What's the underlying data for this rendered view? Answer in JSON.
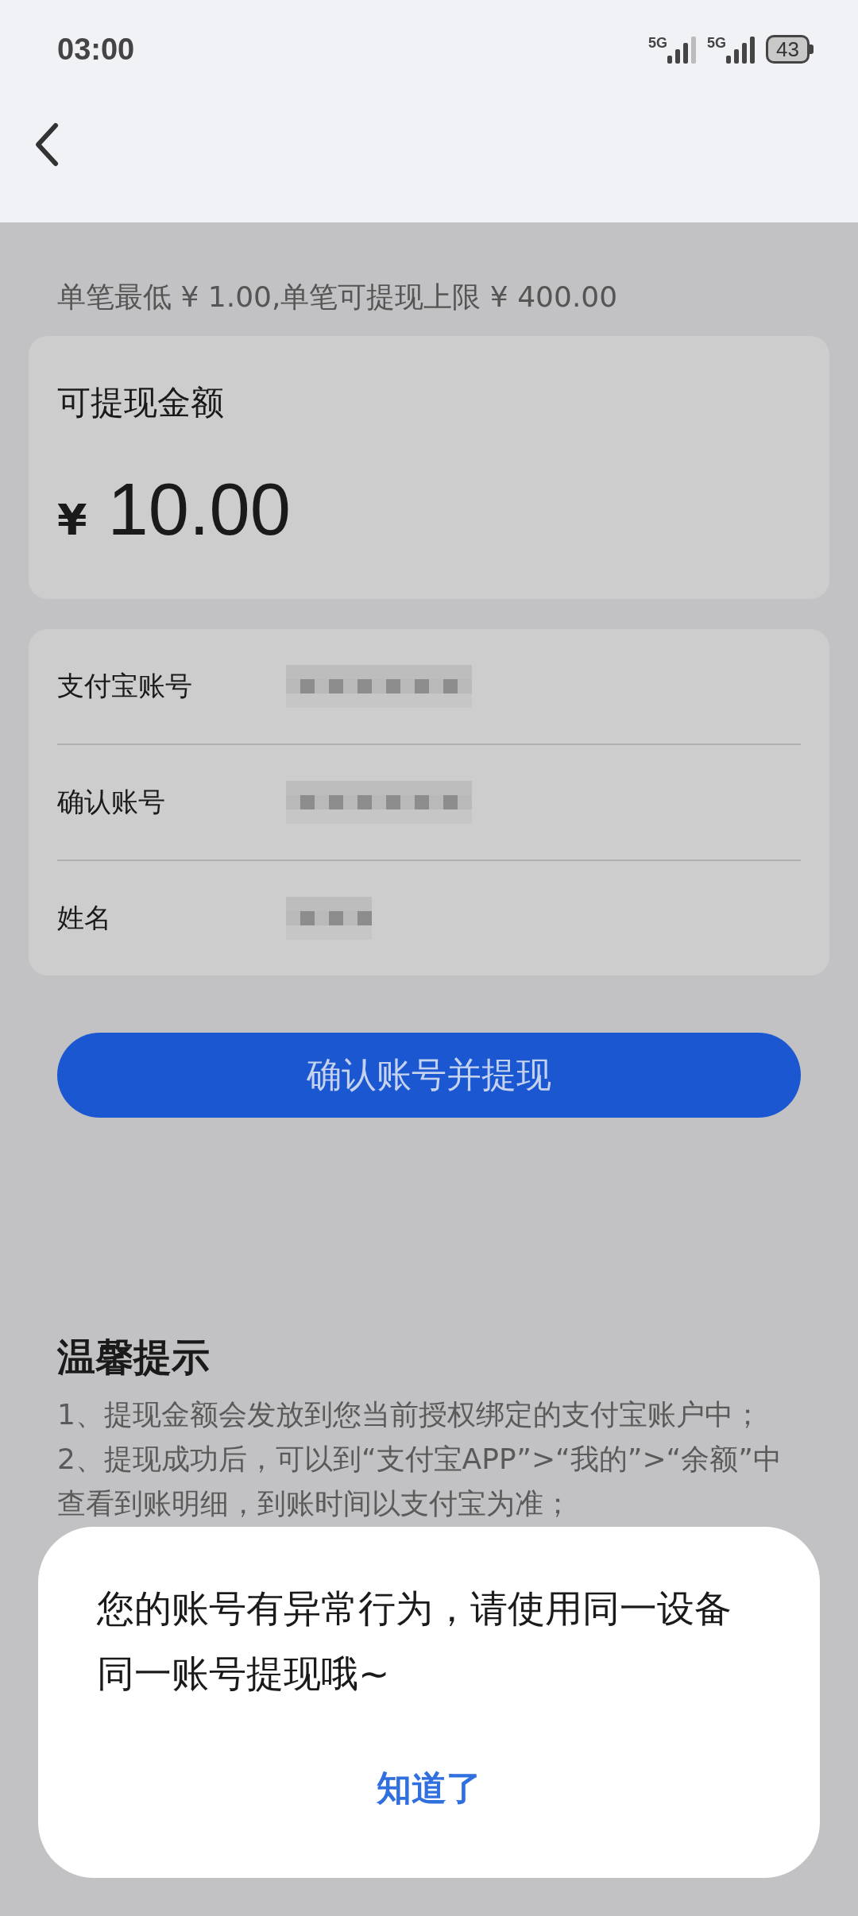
{
  "status_bar": {
    "time": "03:00",
    "signals": [
      {
        "label": "5G"
      },
      {
        "label": "5G"
      }
    ],
    "battery": "43"
  },
  "limit_note": "单笔最低 ¥ 1.00,单笔可提现上限 ¥ 400.00",
  "balance": {
    "label": "可提现金额",
    "currency": "¥",
    "amount": "10.00"
  },
  "form": [
    {
      "label": "支付宝账号",
      "redacted": true
    },
    {
      "label": "确认账号",
      "redacted": true
    },
    {
      "label": "姓名",
      "redacted": true
    }
  ],
  "submit_button": "确认账号并提现",
  "tips": {
    "title": "温馨提示",
    "lines": [
      "1、提现金额会发放到您当前授权绑定的支付宝账户中；",
      "2、提现成功后，可以到“支付宝APP”>“我的”>“余额”中查看到账明细，到账时间以支付宝为准；"
    ]
  },
  "dialog": {
    "message": "您的账号有异常行为，请使用同一设备同一账号提现哦~",
    "button": "知道了"
  }
}
